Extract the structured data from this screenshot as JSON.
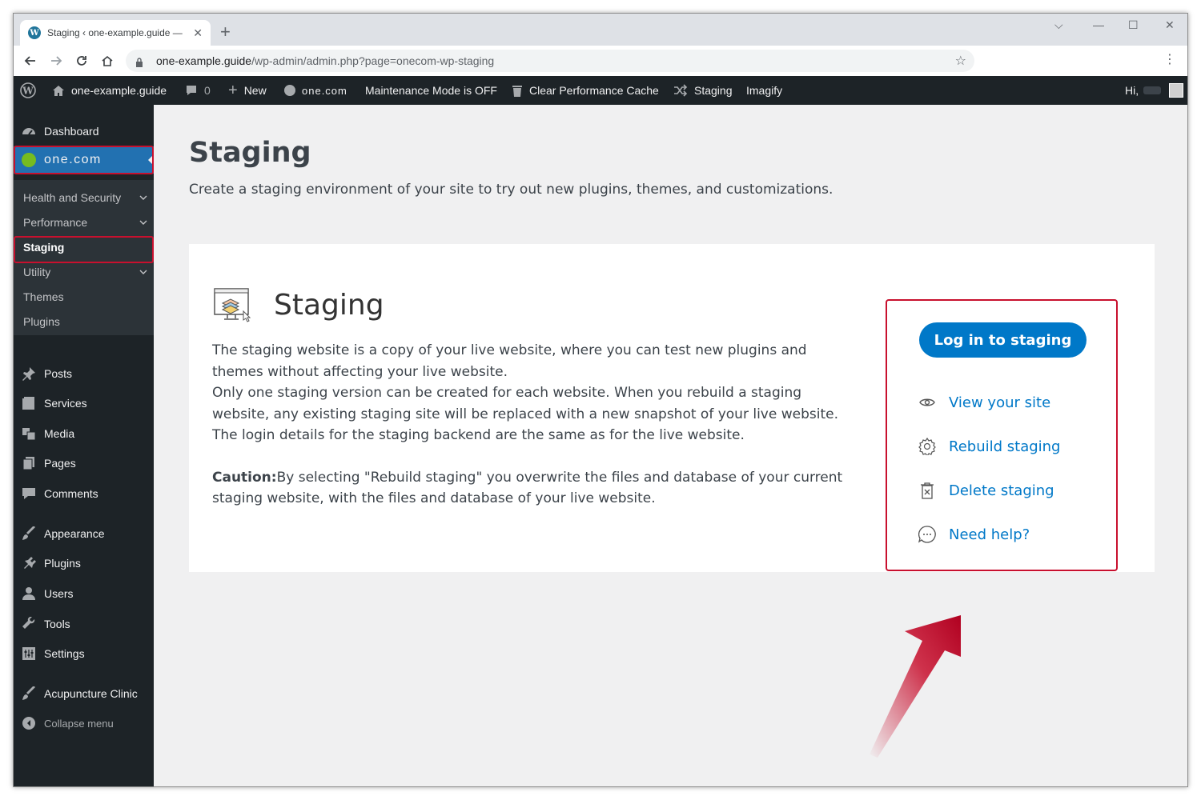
{
  "browser": {
    "tab_title": "Staging ‹ one-example.guide — W",
    "url_host": "one-example.guide",
    "url_path": "/wp-admin/admin.php?page=onecom-wp-staging"
  },
  "adminbar": {
    "site_name": "one-example.guide",
    "comments_count": "0",
    "new_label": "New",
    "onecom_label": "one.com",
    "maintenance_label": "Maintenance Mode is OFF",
    "cache_label": "Clear Performance Cache",
    "staging_label": "Staging",
    "imagify_label": "Imagify",
    "greeting": "Hi,"
  },
  "sidebar": {
    "dashboard": "Dashboard",
    "onecom": "one.com",
    "submenu": [
      {
        "label": "Health and Security",
        "has_children": true
      },
      {
        "label": "Performance",
        "has_children": true
      },
      {
        "label": "Staging",
        "has_children": false,
        "current": true
      },
      {
        "label": "Utility",
        "has_children": true
      },
      {
        "label": "Themes",
        "has_children": false
      },
      {
        "label": "Plugins",
        "has_children": false
      }
    ],
    "items": [
      {
        "label": "Posts",
        "icon": "pin-icon"
      },
      {
        "label": "Services",
        "icon": "services-icon"
      },
      {
        "label": "Media",
        "icon": "media-icon"
      },
      {
        "label": "Pages",
        "icon": "pages-icon"
      },
      {
        "label": "Comments",
        "icon": "comment-icon"
      },
      {
        "label": "Appearance",
        "icon": "brush-icon"
      },
      {
        "label": "Plugins",
        "icon": "plugin-icon"
      },
      {
        "label": "Users",
        "icon": "user-icon"
      },
      {
        "label": "Tools",
        "icon": "wrench-icon"
      },
      {
        "label": "Settings",
        "icon": "settings-icon"
      },
      {
        "label": "Acupuncture Clinic",
        "icon": "brush-icon"
      }
    ],
    "collapse": "Collapse menu"
  },
  "main": {
    "title": "Staging",
    "description": "Create a staging environment of your site to try out new plugins, themes, and customizations.",
    "card": {
      "title": "Staging",
      "para1": "The staging website is a copy of your live website, where you can test new plugins and themes without affecting your live website.",
      "para2": "Only one staging version can be created for each website. When you rebuild a staging website, any existing staging site will be replaced with a new snapshot of your live website.",
      "para3": "The login details for the staging backend are the same as for the live website.",
      "caution_label": "Caution:",
      "caution_text": "By selecting \"Rebuild staging\" you overwrite the files and database of your current staging website, with the files and database of your live website."
    },
    "actions": {
      "login": "Log in to staging",
      "view": "View your site",
      "rebuild": "Rebuild staging",
      "delete": "Delete staging",
      "help": "Need help?"
    }
  },
  "colors": {
    "admin_dark": "#1d2327",
    "accent_blue": "#2271b1",
    "link_blue": "#0078c8",
    "highlight_red": "#c8102e"
  }
}
